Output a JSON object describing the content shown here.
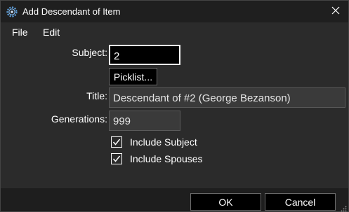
{
  "window": {
    "title": "Add Descendant of Item",
    "app_icon": "app-gear-icon",
    "close_icon": "close-icon"
  },
  "menu": {
    "items": [
      {
        "label": "File"
      },
      {
        "label": "Edit"
      }
    ]
  },
  "form": {
    "subject_label": "Subject:",
    "subject_value": "2",
    "picklist_button": "Picklist...",
    "title_label": "Title:",
    "title_value": "Descendant of #2 (George Bezanson)",
    "generations_label": "Generations:",
    "generations_value": "999",
    "include_subject_label": "Include Subject",
    "include_subject_checked": true,
    "include_spouses_label": "Include Spouses",
    "include_spouses_checked": true
  },
  "buttons": {
    "ok": "OK",
    "cancel": "Cancel"
  },
  "colors": {
    "background": "#2b2b2b",
    "titlebar": "#1f1f1f",
    "input_active_bg": "#000000",
    "input_readonly_bg": "#3a3a3a",
    "text": "#ffffff"
  }
}
